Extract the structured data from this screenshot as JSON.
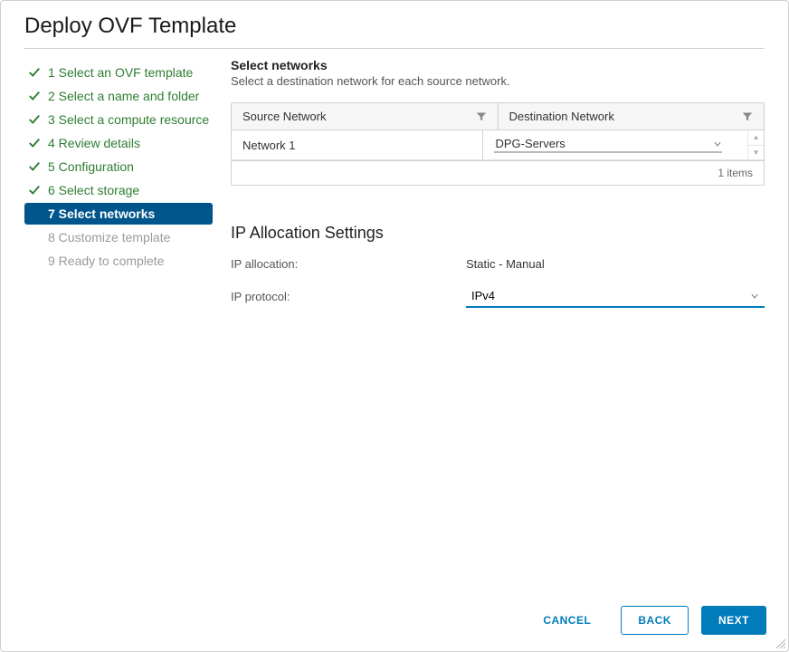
{
  "title": "Deploy OVF Template",
  "steps": [
    {
      "label": "1 Select an OVF template",
      "state": "done"
    },
    {
      "label": "2 Select a name and folder",
      "state": "done"
    },
    {
      "label": "3 Select a compute resource",
      "state": "done"
    },
    {
      "label": "4 Review details",
      "state": "done"
    },
    {
      "label": "5 Configuration",
      "state": "done"
    },
    {
      "label": "6 Select storage",
      "state": "done"
    },
    {
      "label": "7 Select networks",
      "state": "active"
    },
    {
      "label": "8 Customize template",
      "state": "future"
    },
    {
      "label": "9 Ready to complete",
      "state": "future"
    }
  ],
  "section": {
    "title": "Select networks",
    "desc": "Select a destination network for each source network."
  },
  "network_table": {
    "col_source": "Source Network",
    "col_dest": "Destination Network",
    "rows": [
      {
        "source": "Network 1",
        "dest": "DPG-Servers"
      }
    ],
    "footer": "1 items"
  },
  "ip_settings": {
    "heading": "IP Allocation Settings",
    "alloc_label": "IP allocation:",
    "alloc_value": "Static - Manual",
    "proto_label": "IP protocol:",
    "proto_value": "IPv4"
  },
  "buttons": {
    "cancel": "CANCEL",
    "back": "BACK",
    "next": "NEXT"
  }
}
